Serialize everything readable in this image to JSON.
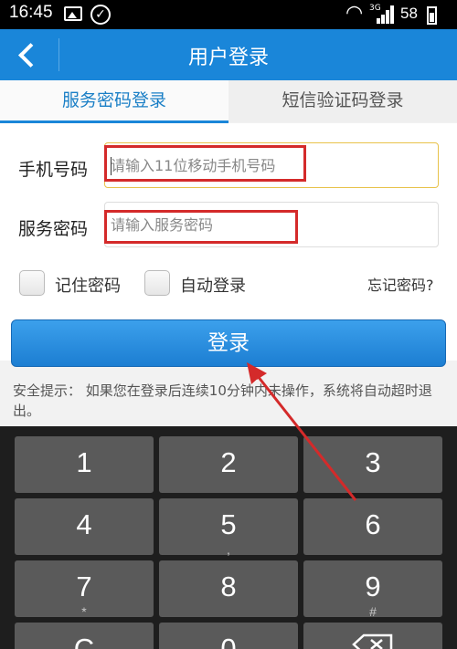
{
  "status_bar": {
    "time": "16:45",
    "network": "3G",
    "battery": "58",
    "icons": [
      "image-icon",
      "check-circle-icon",
      "wifi-icon",
      "signal-icon",
      "battery-icon"
    ]
  },
  "header": {
    "title": "用户登录",
    "back_icon": "back-arrow-icon"
  },
  "tabs": [
    {
      "label": "服务密码登录",
      "active": true
    },
    {
      "label": "短信验证码登录",
      "active": false
    }
  ],
  "form": {
    "phone_label": "手机号码",
    "phone_placeholder": "请输入11位移动手机号码",
    "password_label": "服务密码",
    "password_placeholder": "请输入服务密码",
    "remember_label": "记住密码",
    "auto_login_label": "自动登录",
    "forgot_label": "忘记密码?",
    "login_label": "登录"
  },
  "tip": {
    "text": "安全提示： 如果您在登录后连续10分钟内未操作，系统将自动超时退出。"
  },
  "keyboard": {
    "keys": [
      {
        "num": "1",
        "sub": ""
      },
      {
        "num": "2",
        "sub": ""
      },
      {
        "num": "3",
        "sub": ""
      },
      {
        "num": "4",
        "sub": ""
      },
      {
        "num": "5",
        "sub": ","
      },
      {
        "num": "6",
        "sub": ""
      },
      {
        "num": "7",
        "sub": "*"
      },
      {
        "num": "8",
        "sub": ""
      },
      {
        "num": "9",
        "sub": "#"
      },
      {
        "num": "C",
        "sub": ""
      },
      {
        "num": "0",
        "sub": ""
      }
    ],
    "backspace_icon": "backspace-icon"
  },
  "colors": {
    "title_bar": "#1a86d9",
    "login_button": "#2a8fe0",
    "annotation": "#d42a2a"
  }
}
